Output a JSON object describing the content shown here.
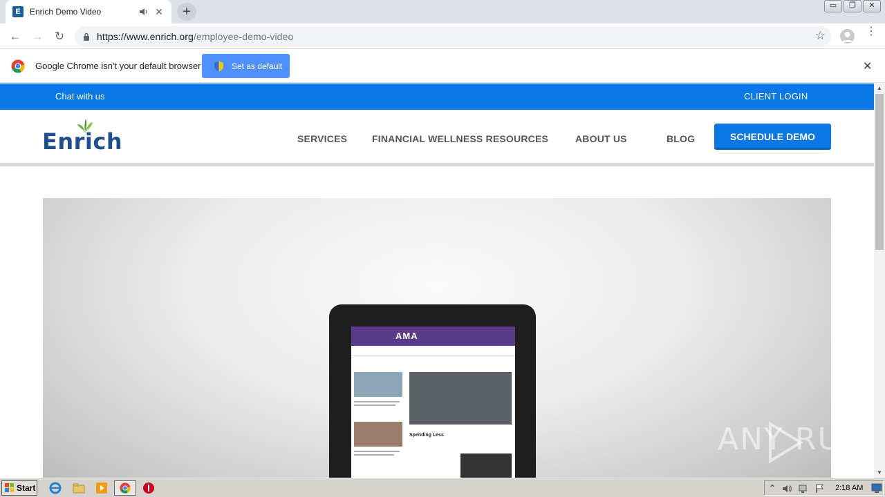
{
  "browser": {
    "tab": {
      "title": "Enrich Demo Video",
      "close": "✕"
    },
    "new_tab": "+",
    "window_controls": {
      "minimize": "▭",
      "restore": "❐",
      "close": "✕"
    },
    "nav": {
      "back": "←",
      "forward": "→",
      "reload": "↻"
    },
    "url_host": "https://www.enrich.org",
    "url_path": "/employee-demo-video",
    "bookmark_star": "☆",
    "menu": "⋮"
  },
  "infobar": {
    "message": "Google Chrome isn't your default browser",
    "set_default_label": "Set as default",
    "close": "✕"
  },
  "site": {
    "topbar": {
      "chat": "Chat with us",
      "client_login": "CLIENT LOGIN"
    },
    "logo": "Enrich",
    "nav": [
      {
        "label": "SERVICES"
      },
      {
        "label": "FINANCIAL WELLNESS RESOURCES"
      },
      {
        "label": "ABOUT US"
      },
      {
        "label": "BLOG"
      }
    ],
    "cta": "SCHEDULE DEMO"
  },
  "video": {
    "tablet_screen": {
      "brand": "AMA",
      "section": "Spending Less"
    }
  },
  "watermark": "ANY  RUN",
  "taskbar": {
    "start": "Start",
    "clock": "2:18 AM",
    "tray_expand": "⌃"
  },
  "colors": {
    "brand_blue": "#0a78e6",
    "logo_navy": "#1f4e8c",
    "logo_green": "#6bb33f",
    "chrome_button": "#4d90fe"
  }
}
